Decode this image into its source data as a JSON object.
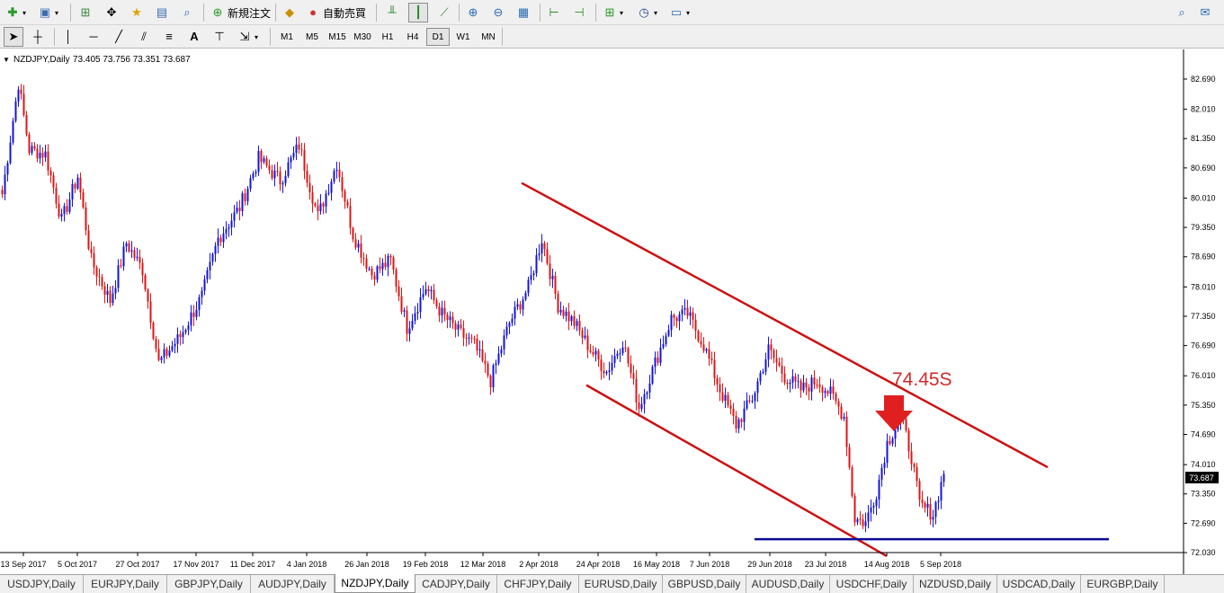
{
  "toolbar": {
    "new_order_label": "新規注文",
    "auto_trade_label": "自動売買",
    "timeframes": [
      "M1",
      "M5",
      "M15",
      "M30",
      "H1",
      "H4",
      "D1",
      "W1",
      "MN"
    ],
    "active_timeframe": "D1"
  },
  "chart_header": {
    "symbol": "NZDJPY,Daily",
    "ohlc": "73.405 73.756 73.351 73.687"
  },
  "current_price": "73.687",
  "annotation_text": "74.45S",
  "colors": {
    "bull": "#1515d8",
    "bear": "#dd1515",
    "trendline": "#cc1111",
    "support": "#0a0a9a",
    "price_box": "#000000"
  },
  "chart_data": {
    "type": "candlestick",
    "title": "NZDJPY,Daily",
    "y_ticks": [
      "82.690",
      "82.010",
      "81.350",
      "80.690",
      "80.010",
      "79.350",
      "78.690",
      "78.010",
      "77.350",
      "76.690",
      "76.010",
      "75.350",
      "74.690",
      "74.010",
      "73.350",
      "72.690",
      "72.030"
    ],
    "ylim": [
      72.03,
      82.69
    ],
    "x_ticks": [
      "13 Sep 2017",
      "5 Oct 2017",
      "27 Oct 2017",
      "17 Nov 2017",
      "11 Dec 2017",
      "4 Jan 2018",
      "26 Jan 2018",
      "19 Feb 2018",
      "12 Mar 2018",
      "2 Apr 2018",
      "24 Apr 2018",
      "16 May 2018",
      "7 Jun 2018",
      "29 Jun 2018",
      "23 Jul 2018",
      "14 Aug 2018",
      "5 Sep 2018"
    ],
    "anchors": [
      [
        0,
        80.1
      ],
      [
        6,
        82.6
      ],
      [
        10,
        81.1
      ],
      [
        16,
        81.0
      ],
      [
        22,
        79.5
      ],
      [
        28,
        80.5
      ],
      [
        33,
        78.6
      ],
      [
        40,
        77.7
      ],
      [
        46,
        79.0
      ],
      [
        52,
        78.4
      ],
      [
        58,
        76.3
      ],
      [
        66,
        76.9
      ],
      [
        74,
        77.8
      ],
      [
        80,
        79.1
      ],
      [
        88,
        79.8
      ],
      [
        95,
        80.9
      ],
      [
        103,
        80.4
      ],
      [
        110,
        81.2
      ],
      [
        117,
        79.6
      ],
      [
        124,
        80.8
      ],
      [
        130,
        79.2
      ],
      [
        137,
        78.3
      ],
      [
        144,
        78.6
      ],
      [
        150,
        77.1
      ],
      [
        157,
        78.0
      ],
      [
        163,
        77.4
      ],
      [
        169,
        77.0
      ],
      [
        175,
        76.7
      ],
      [
        181,
        75.9
      ],
      [
        188,
        77.2
      ],
      [
        195,
        78.0
      ],
      [
        200,
        79.1
      ],
      [
        206,
        77.6
      ],
      [
        212,
        77.2
      ],
      [
        218,
        76.6
      ],
      [
        224,
        76.1
      ],
      [
        230,
        76.8
      ],
      [
        236,
        75.3
      ],
      [
        242,
        76.3
      ],
      [
        248,
        77.3
      ],
      [
        254,
        77.4
      ],
      [
        260,
        76.7
      ],
      [
        266,
        75.7
      ],
      [
        272,
        74.9
      ],
      [
        278,
        75.5
      ],
      [
        284,
        76.6
      ],
      [
        290,
        76.0
      ],
      [
        296,
        75.7
      ],
      [
        302,
        75.9
      ],
      [
        307,
        75.6
      ],
      [
        312,
        75.1
      ],
      [
        316,
        72.8
      ],
      [
        320,
        72.7
      ],
      [
        324,
        73.4
      ],
      [
        328,
        74.5
      ],
      [
        333,
        75.1
      ],
      [
        337,
        74.2
      ],
      [
        340,
        73.1
      ],
      [
        345,
        72.9
      ],
      [
        349,
        73.8
      ]
    ],
    "last_bar_index": 349,
    "trendlines": [
      {
        "name": "upper-channel",
        "from": [
          "2 Apr 2018",
          79.85
        ],
        "to": [
          "5 Sep 2018",
          74.0
        ]
      },
      {
        "name": "lower-channel",
        "from": [
          "24 Apr 2018",
          75.7
        ],
        "to": [
          "14 Aug 2018",
          72.03
        ]
      },
      {
        "name": "support",
        "from": [
          "29 Jun 2018",
          72.33
        ],
        "to": [
          "5 Sep 2018",
          72.33
        ]
      }
    ],
    "grid": false,
    "legend": "none"
  }
}
